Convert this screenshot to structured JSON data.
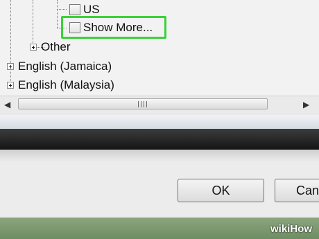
{
  "tree": {
    "items": [
      {
        "label": "US",
        "checked": false
      },
      {
        "label": "Show More...",
        "checked": false,
        "highlighted": true
      },
      {
        "label": "Other",
        "expander": "plus"
      },
      {
        "label": "English (Jamaica)",
        "expander": "plus"
      },
      {
        "label": "English (Malaysia)",
        "expander": "plus"
      }
    ]
  },
  "scrollbar": {
    "left_arrow": "◀",
    "right_arrow": "▶"
  },
  "dialog": {
    "ok_label": "OK",
    "cancel_label": "Canc"
  },
  "watermark": {
    "text": "wikiHow"
  },
  "colors": {
    "highlight_border": "#3ad13a",
    "panel_bg": "#f2f2f2",
    "dark_band": "#1a1a1a"
  }
}
